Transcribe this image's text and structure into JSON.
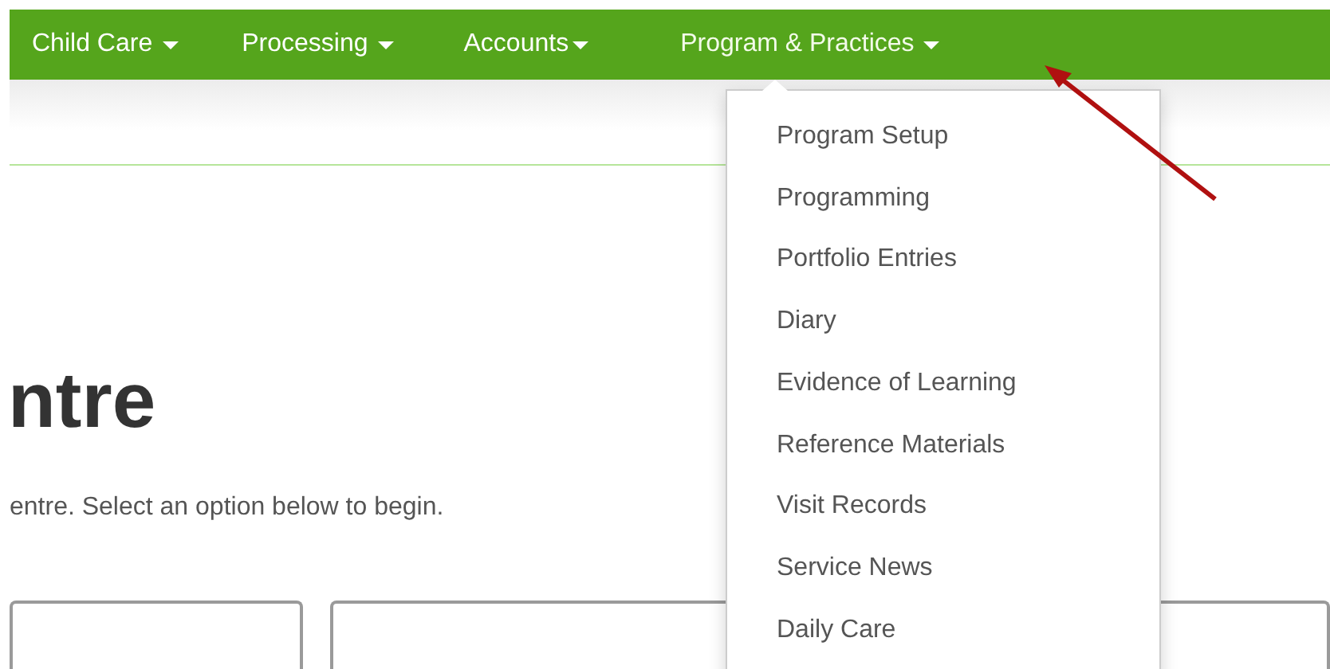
{
  "navbar": {
    "items": [
      {
        "label": "Child Care",
        "expanded": false
      },
      {
        "label": "Processing",
        "expanded": false
      },
      {
        "label": "Accounts",
        "expanded": false
      },
      {
        "label": "Program & Practices",
        "expanded": true
      }
    ]
  },
  "dropdown": {
    "items": [
      "Program Setup",
      "Programming",
      "Portfolio Entries",
      "Diary",
      "Evidence of Learning",
      "Reference Materials",
      "Visit Records",
      "Service News",
      "Daily Care"
    ]
  },
  "page": {
    "heading": "ntre",
    "intro": "entre. Select an option below to begin."
  }
}
